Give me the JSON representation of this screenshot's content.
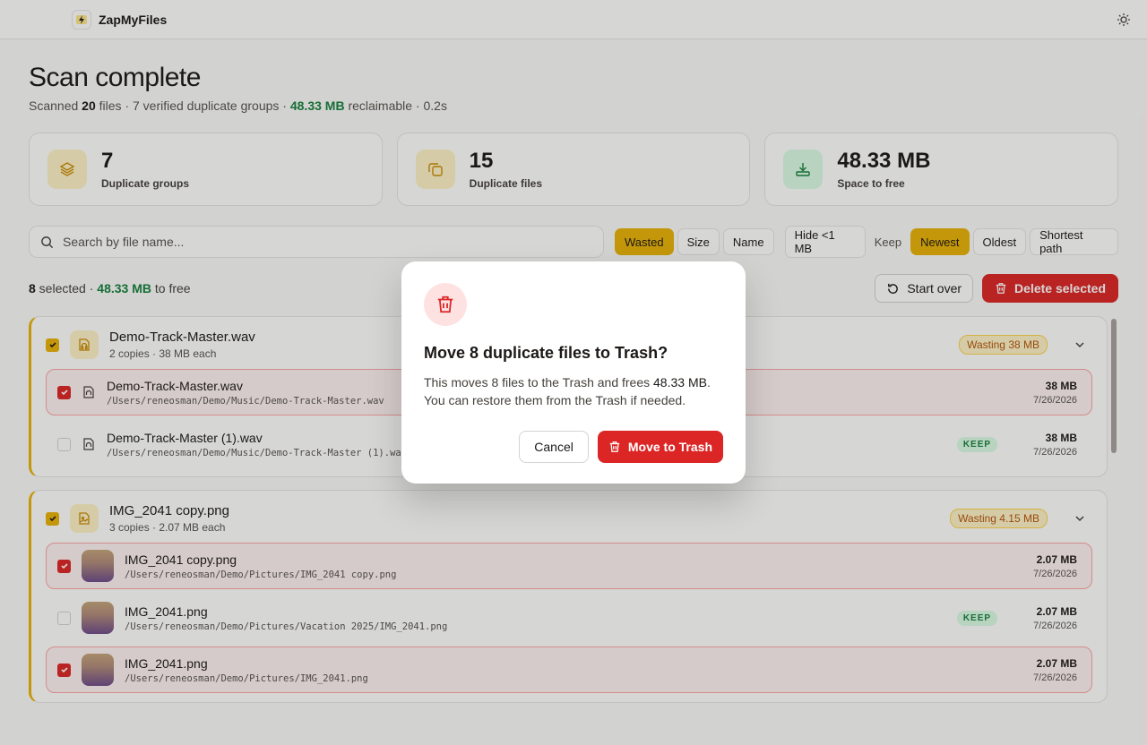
{
  "app": {
    "name": "ZapMyFiles"
  },
  "header": {
    "title": "Scan complete",
    "summary_prefix": "Scanned ",
    "files_count": "20",
    "summary_mid": " files · 7 verified duplicate groups · ",
    "reclaimable": "48.33 MB",
    "summary_suffix": " reclaimable · 0.2s"
  },
  "stats": [
    {
      "value": "7",
      "label": "Duplicate groups",
      "icon": "layers-icon",
      "color": "#eab308"
    },
    {
      "value": "15",
      "label": "Duplicate files",
      "icon": "copy-icon",
      "color": "#eab308"
    },
    {
      "value": "48.33 MB",
      "label": "Space to free",
      "icon": "download-icon",
      "color": "#15803d"
    }
  ],
  "search": {
    "placeholder": "Search by file name..."
  },
  "sort": {
    "options": [
      "Wasted",
      "Size",
      "Name"
    ],
    "active": "Wasted"
  },
  "filter": {
    "hide_small": "Hide <1 MB"
  },
  "keep": {
    "label": "Keep",
    "options": [
      "Newest",
      "Oldest",
      "Shortest path"
    ],
    "active": "Newest"
  },
  "selection": {
    "count": "8",
    "mid": " selected · ",
    "size": "48.33 MB",
    "suffix": " to free",
    "start_over": "Start over",
    "delete_selected": "Delete selected"
  },
  "groups": [
    {
      "name": "Demo-Track-Master.wav",
      "sub": "2 copies · 38 MB each",
      "wasting": "Wasting 38 MB",
      "files": [
        {
          "name": "Demo-Track-Master.wav",
          "path": "/Users/reneosman/Demo/Music/Demo-Track-Master.wav",
          "size": "38 MB",
          "date": "7/26/2026",
          "selected": true,
          "keep": ""
        },
        {
          "name": "Demo-Track-Master (1).wav",
          "path": "/Users/reneosman/Demo/Music/Demo-Track-Master (1).wav",
          "size": "38 MB",
          "date": "7/26/2026",
          "selected": false,
          "keep": "KEEP"
        }
      ]
    },
    {
      "name": "IMG_2041 copy.png",
      "sub": "3 copies · 2.07 MB each",
      "wasting": "Wasting 4.15 MB",
      "files": [
        {
          "name": "IMG_2041 copy.png",
          "path": "/Users/reneosman/Demo/Pictures/IMG_2041 copy.png",
          "size": "2.07 MB",
          "date": "7/26/2026",
          "selected": true,
          "keep": ""
        },
        {
          "name": "IMG_2041.png",
          "path": "/Users/reneosman/Demo/Pictures/Vacation 2025/IMG_2041.png",
          "size": "2.07 MB",
          "date": "7/26/2026",
          "selected": false,
          "keep": "KEEP"
        },
        {
          "name": "IMG_2041.png",
          "path": "/Users/reneosman/Demo/Pictures/IMG_2041.png",
          "size": "2.07 MB",
          "date": "7/26/2026",
          "selected": true,
          "keep": ""
        }
      ]
    }
  ],
  "modal": {
    "title": "Move 8 duplicate files to Trash?",
    "body_prefix": "This moves 8 files to the Trash and frees ",
    "body_size": "48.33 MB",
    "body_suffix": ".",
    "body_line2": "You can restore them from the Trash if needed.",
    "cancel": "Cancel",
    "confirm": "Move to Trash"
  },
  "colors": {
    "accent": "#eab308",
    "danger": "#dc2626",
    "success": "#15803d"
  }
}
